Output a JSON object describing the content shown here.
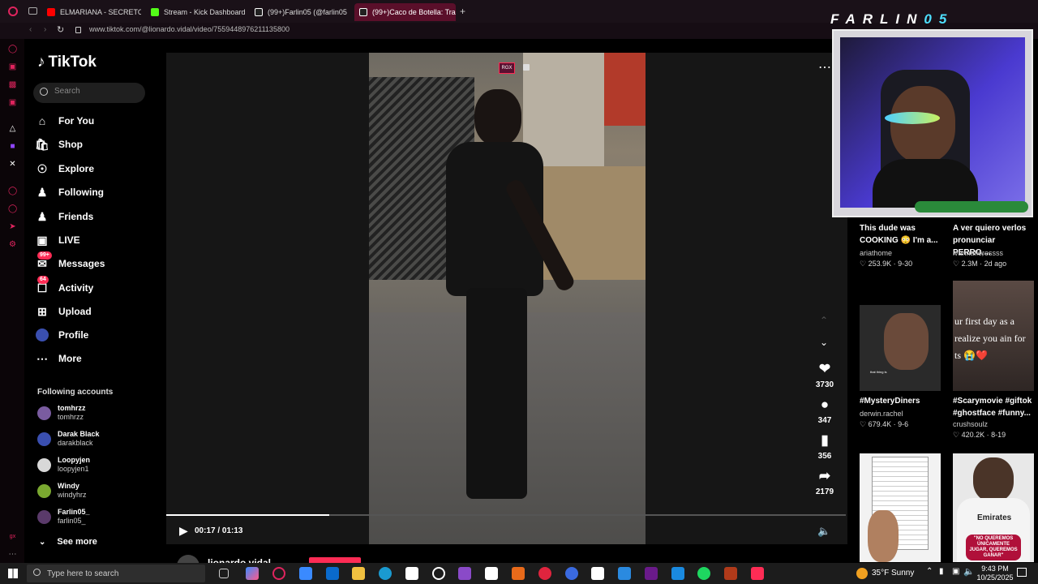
{
  "tabs": [
    {
      "label": "ELMARIANA - SECRETO D",
      "icon": "youtube-icon",
      "color": "#ff0000"
    },
    {
      "label": "Stream - Kick Dashboard",
      "icon": "kick-icon",
      "color": "#53fc18"
    },
    {
      "label": "(99+)Farlin05 (@farlin05",
      "icon": "tiktok-icon",
      "color": "#ffffff"
    },
    {
      "label": "(99+)Caco de Botella: Tra",
      "icon": "tiktok-icon",
      "color": "#ffffff"
    }
  ],
  "url": "www.tiktok.com/@lionardo.vidal/video/7559448976211135800",
  "tiktok": {
    "logo": "TikTok",
    "search_placeholder": "Search",
    "nav": [
      {
        "label": "For You",
        "icon": "home-icon"
      },
      {
        "label": "Shop",
        "icon": "shop-icon"
      },
      {
        "label": "Explore",
        "icon": "compass-icon"
      },
      {
        "label": "Following",
        "icon": "following-icon"
      },
      {
        "label": "Friends",
        "icon": "friends-icon"
      },
      {
        "label": "LIVE",
        "icon": "live-icon"
      },
      {
        "label": "Messages",
        "icon": "messages-icon",
        "badge": "99+"
      },
      {
        "label": "Activity",
        "icon": "activity-icon",
        "badge": "64"
      },
      {
        "label": "Upload",
        "icon": "upload-icon"
      },
      {
        "label": "Profile",
        "icon": "profile-icon"
      },
      {
        "label": "More",
        "icon": "more-icon"
      }
    ],
    "following_title": "Following accounts",
    "accounts": [
      {
        "name": "tomhrzz",
        "handle": "tomhrzz",
        "color": "#7a5ca0"
      },
      {
        "name": "Darak Black",
        "handle": "darakblack",
        "color": "#3a4fb0"
      },
      {
        "name": "Loopyjen",
        "handle": "loopyjen1",
        "color": "#d8d8d8"
      },
      {
        "name": "Windy",
        "handle": "windyhrz",
        "color": "#7aa830"
      },
      {
        "name": "Farlin05_",
        "handle": "farlin05_",
        "color": "#5a3a6a"
      }
    ],
    "see_more": "See more"
  },
  "player": {
    "time": "00:17 / 01:13",
    "progress": 0.24,
    "author": "lionardo.vidal",
    "likes": "3730",
    "comments": "347",
    "saves": "356",
    "shares": "2179",
    "overlay_tag": "RGX"
  },
  "cards": [
    {
      "title": "This dude was COOKING 😳 I'm a...",
      "author": "ariathome",
      "stats": "♡ 253.9K · 9-30"
    },
    {
      "title": "A ver quiero verlos pronunciar PERRO,...",
      "author": "ivannafloressss",
      "stats": "♡ 2.3M · 2d ago"
    },
    {
      "title": "#MysteryDiners",
      "author": "derwin.rachel",
      "stats": "♡ 679.4K · 9-6",
      "thumb_caption": "that thing is"
    },
    {
      "title": "#Scarymovie #giftok #ghostface #funny...",
      "author": "crushsoulz",
      "stats": "♡ 420.2K · 8-19",
      "thumb_caption": "ur first day as a realize you ain for ts 😭❤️"
    },
    {
      "thumb_caption": "\"NO QUEREMOS ÚNICAMENTE JUGAR, QUEREMOS GANAR\"",
      "shirt_text": "Emirates"
    }
  ],
  "overlay": {
    "brand_main": "FARLIN",
    "brand_accent": "05"
  },
  "taskbar": {
    "search_placeholder": "Type here to search",
    "weather": "35°F  Sunny",
    "time": "9:43 PM",
    "date": "10/25/2025"
  },
  "colors": {
    "accent": "#fe2c55",
    "browser_accent": "#e0245e"
  }
}
